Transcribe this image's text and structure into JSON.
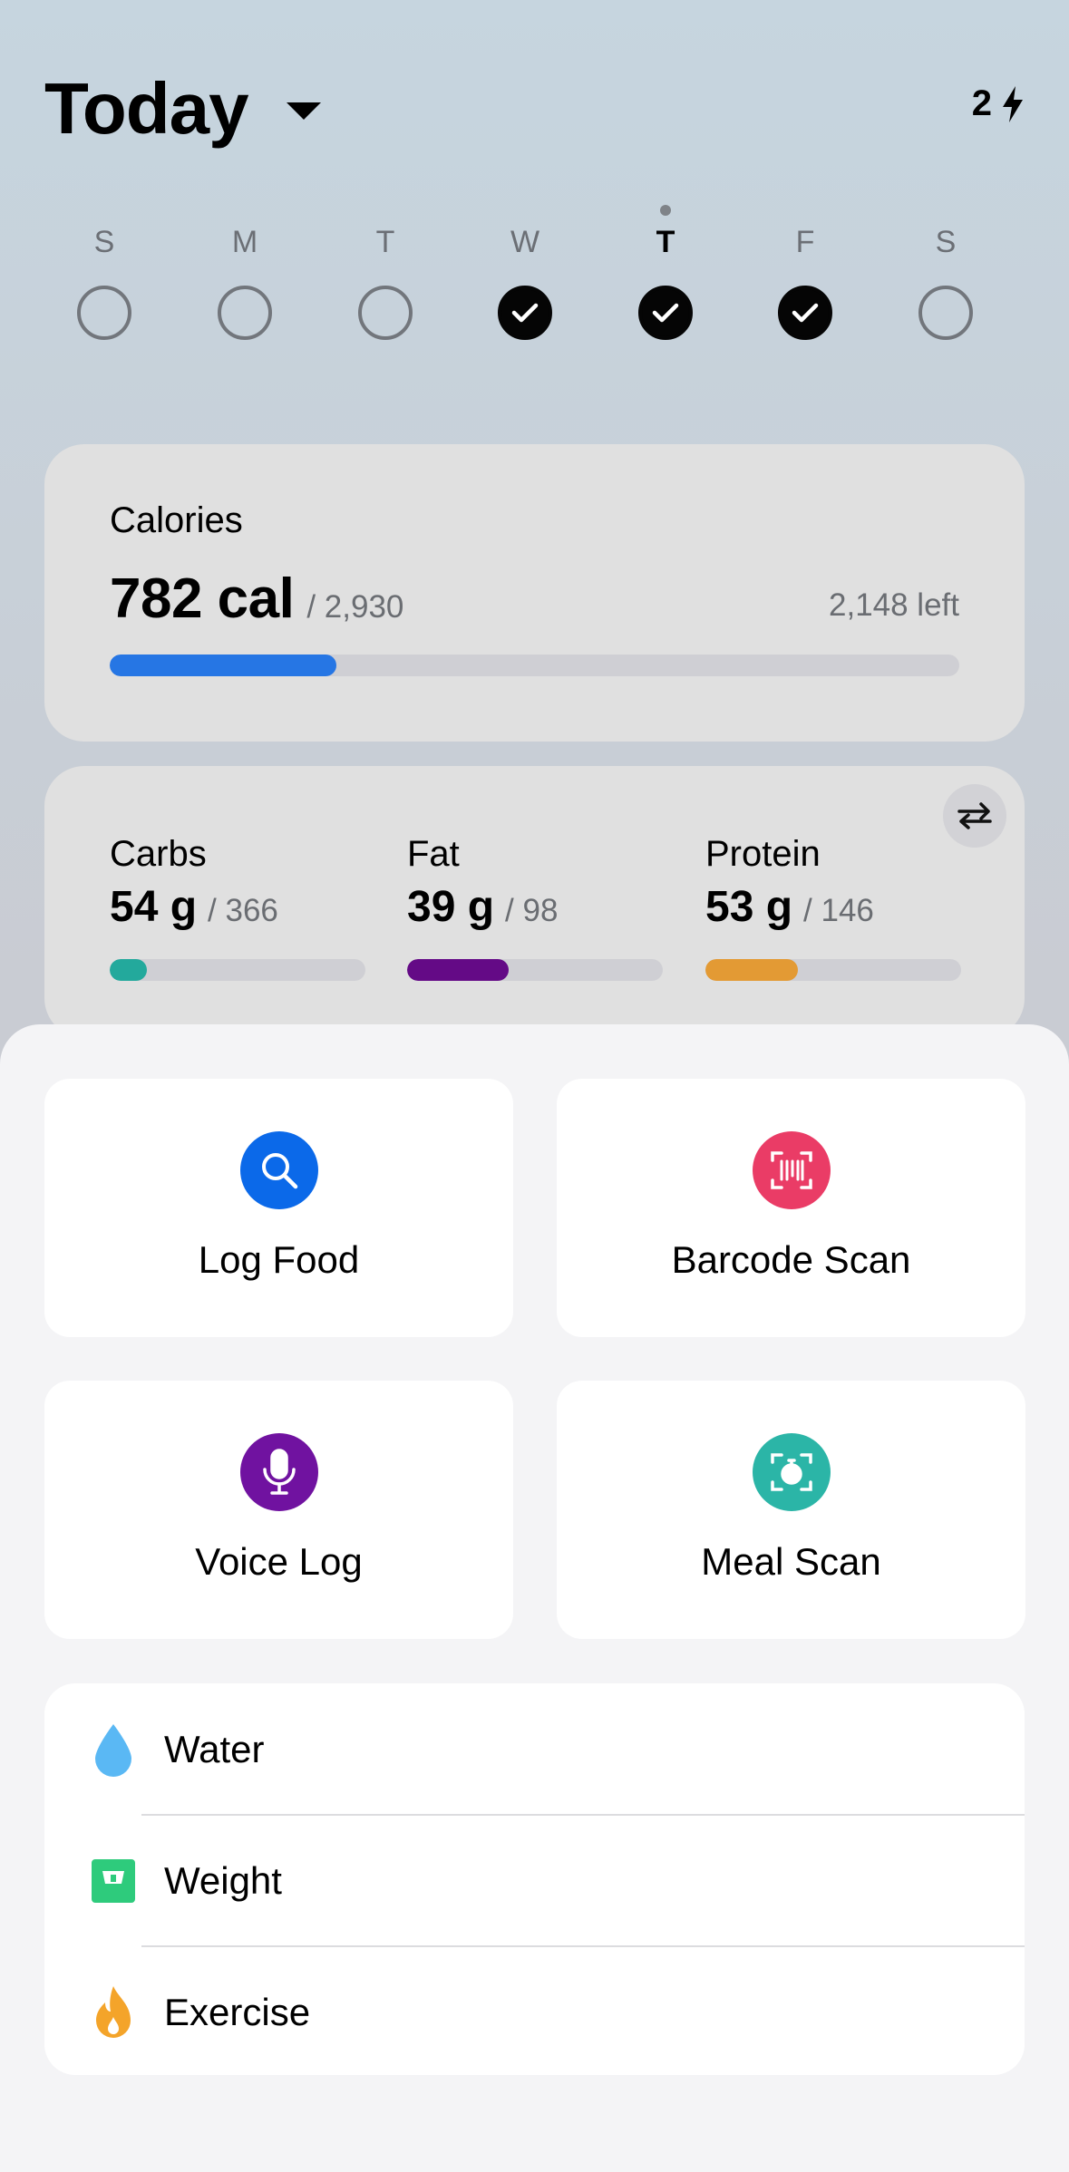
{
  "header": {
    "title": "Today",
    "streak_count": "2",
    "streak_icon": "bolt-icon"
  },
  "week": {
    "days": [
      {
        "letter": "S",
        "completed": false,
        "today": false
      },
      {
        "letter": "M",
        "completed": false,
        "today": false
      },
      {
        "letter": "T",
        "completed": false,
        "today": false
      },
      {
        "letter": "W",
        "completed": true,
        "today": false
      },
      {
        "letter": "T",
        "completed": true,
        "today": true
      },
      {
        "letter": "F",
        "completed": true,
        "today": false
      },
      {
        "letter": "S",
        "completed": false,
        "today": false
      }
    ]
  },
  "calories": {
    "label": "Calories",
    "value": "782 cal",
    "goal": "/ 2,930",
    "remaining": "2,148 left",
    "progress": 0.267,
    "color": "#2676e4"
  },
  "macros": {
    "items": [
      {
        "label": "Carbs",
        "value": "54 g",
        "goal": "/ 366",
        "progress": 0.147,
        "color": "#23a99c"
      },
      {
        "label": "Fat",
        "value": "39 g",
        "goal": "/ 98",
        "progress": 0.398,
        "color": "#640a86"
      },
      {
        "label": "Protein",
        "value": "53 g",
        "goal": "/ 146",
        "progress": 0.363,
        "color": "#e39a34"
      }
    ]
  },
  "actions": {
    "log_food": {
      "label": "Log Food",
      "icon": "search-icon",
      "color": "#0b69e9"
    },
    "barcode_scan": {
      "label": "Barcode Scan",
      "icon": "barcode-icon",
      "color": "#ea3c66"
    },
    "voice_log": {
      "label": "Voice Log",
      "icon": "microphone-icon",
      "color": "#7012a0"
    },
    "meal_scan": {
      "label": "Meal Scan",
      "icon": "camera-scan-icon",
      "color": "#2bb5a7"
    }
  },
  "trackers": {
    "water": {
      "label": "Water",
      "icon": "water-drop-icon",
      "color": "#5ab8f4"
    },
    "weight": {
      "label": "Weight",
      "icon": "scale-icon",
      "color": "#2ecb7c"
    },
    "exercise": {
      "label": "Exercise",
      "icon": "flame-icon",
      "color": "#f4a42a"
    }
  }
}
